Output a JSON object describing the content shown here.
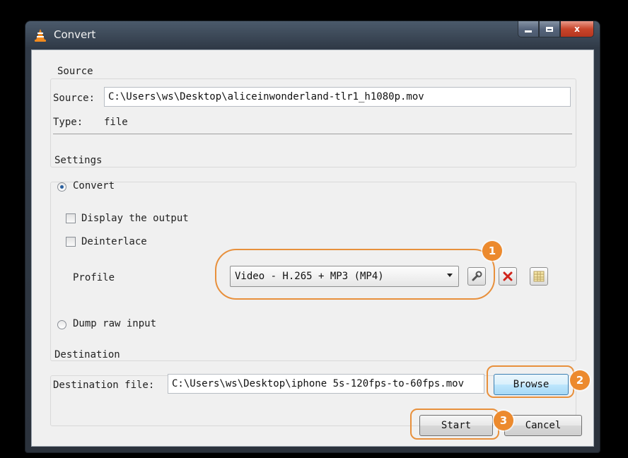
{
  "window": {
    "title": "Convert",
    "icon": "vlc-cone-icon",
    "buttons": {
      "minimize": "minimize-icon",
      "maximize": "maximize-icon",
      "close": "x"
    }
  },
  "source": {
    "group_title": "Source",
    "source_label": "Source:",
    "source_value": "C:\\Users\\ws\\Desktop\\aliceinwonderland-tlr1_h1080p.mov",
    "type_label": "Type:",
    "type_value": "file"
  },
  "settings": {
    "group_title": "Settings",
    "convert_label": "Convert",
    "convert_checked": true,
    "display_output_label": "Display the output",
    "deinterlace_label": "Deinterlace",
    "profile_label": "Profile",
    "profile_value": "Video - H.265 + MP3 (MP4)",
    "dump_raw_label": "Dump raw input"
  },
  "destination": {
    "group_title": "Destination",
    "file_label": "Destination file:",
    "file_value": "C:\\Users\\ws\\Desktop\\iphone 5s-120fps-to-60fps.mov",
    "browse_label": "Browse"
  },
  "actions": {
    "start_label": "Start",
    "cancel_label": "Cancel"
  },
  "annotations": {
    "badge1": "1",
    "badge2": "2",
    "badge3": "3",
    "color": "#e8903c"
  }
}
